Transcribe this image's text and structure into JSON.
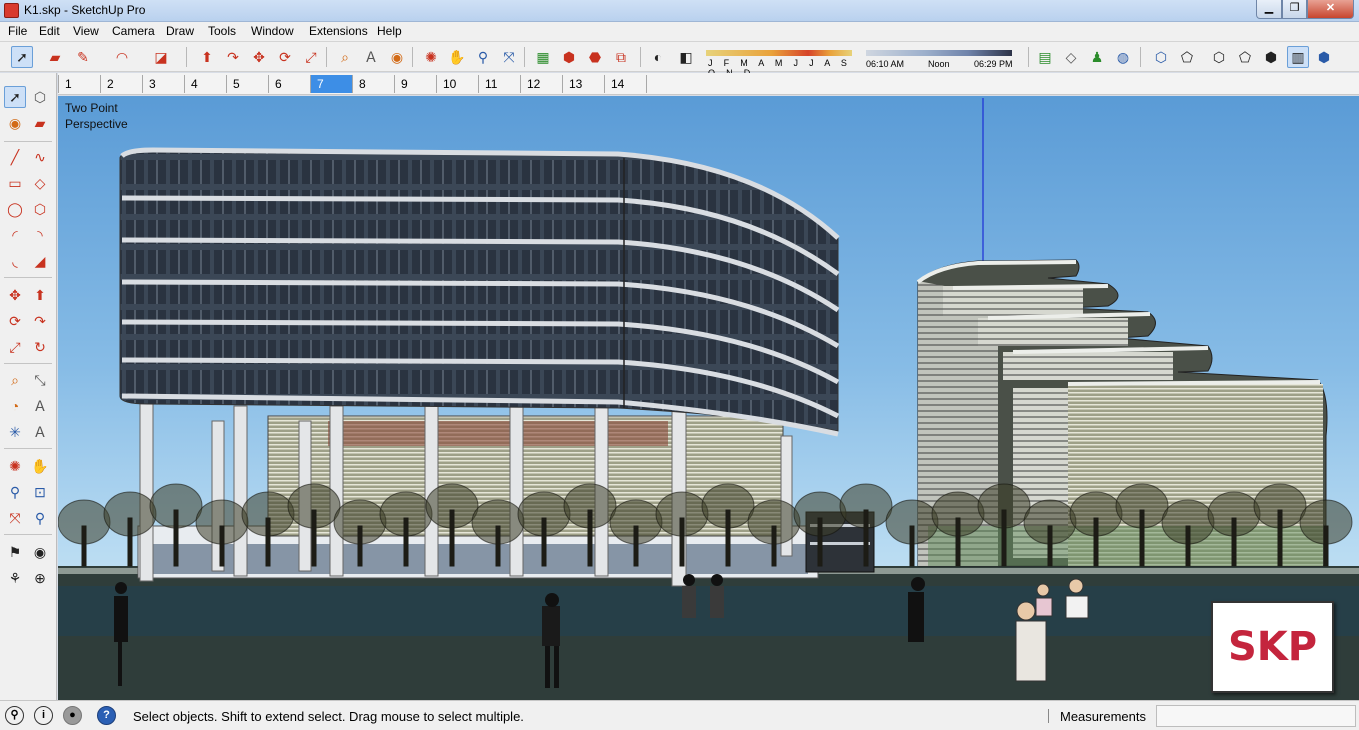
{
  "window": {
    "title": "K1.skp - SketchUp Pro",
    "minimize": "▁",
    "maximize": "❐",
    "close": "✕"
  },
  "menu": [
    "File",
    "Edit",
    "View",
    "Camera",
    "Draw",
    "Tools",
    "Window",
    "Extensions",
    "Help"
  ],
  "shadow_settings": {
    "months": "J F M A M J J A S O N D",
    "time_start": "06:10 AM",
    "time_noon": "Noon",
    "time_end": "06:29 PM"
  },
  "scenes": {
    "tabs": [
      "1",
      "2",
      "3",
      "4",
      "5",
      "6",
      "7",
      "8",
      "9",
      "10",
      "11",
      "12",
      "13",
      "14"
    ],
    "active": "7"
  },
  "viewport": {
    "camera_line1": "Two Point",
    "camera_line2": "Perspective",
    "logo_text": "SKP"
  },
  "status": {
    "message": "Select objects. Shift to extend select. Drag mouse to select multiple.",
    "measurements_label": "Measurements",
    "measurements_value": ""
  },
  "colors": {
    "accent": "#3d8ee6",
    "logo": "#c4253d",
    "sky_top": "#5a9bd6",
    "ground": "#2f3d3a"
  }
}
